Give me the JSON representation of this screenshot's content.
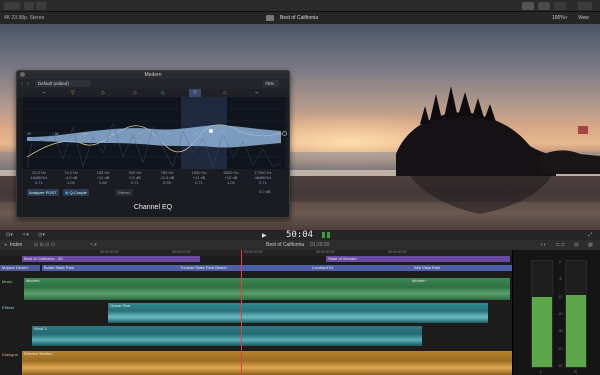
{
  "viewer_header": {
    "format": "4K 23.98p, Stereo",
    "library_title": "Best of California",
    "zoom": "100%",
    "view_label": "View"
  },
  "eq": {
    "window_title": "Modern",
    "preset": "Default (edited)",
    "percent": "75%",
    "name": "Channel EQ",
    "analyzer_label": "Analyzer",
    "analyzer_state": "POST",
    "q_couple": "Q-Couple",
    "processing": "Stereo",
    "freq_ticks": [
      "20",
      "50",
      "100",
      "200",
      "500",
      "1k",
      "2k",
      "5k",
      "10k",
      "20k"
    ],
    "bands": [
      {
        "freq": "20.0 Hz",
        "gain": "18dB/Oct",
        "q": "0.71"
      },
      {
        "freq": "74.0 Hz",
        "gain": "-4.0 dB",
        "q": "1.00"
      },
      {
        "freq": "105 Hz",
        "gain": "+12 dB",
        "q": "0.80"
      },
      {
        "freq": "500 Hz",
        "gain": "0.0 dB",
        "q": "0.71"
      },
      {
        "freq": "780 Hz",
        "gain": "-11.5 dB",
        "q": "0.39"
      },
      {
        "freq": "1500 Hz",
        "gain": "+11 dB",
        "q": "0.71"
      },
      {
        "freq": "6000 Hz",
        "gain": "+12 dB",
        "q": "1.00"
      },
      {
        "freq": "17000 Hz",
        "gain": "48dB/Oct",
        "q": "0.71"
      }
    ],
    "gain_out": "0.0 dB"
  },
  "playback": {
    "timecode": "50:04"
  },
  "timeline_header": {
    "index_label": "Index",
    "project": "Best of California",
    "duration": "01:20:20"
  },
  "ruler": [
    "00:00:00:00",
    "00:00:10:00",
    "00:00:20:00",
    "00:00:30:00",
    "00:00:40:00"
  ],
  "timeline": {
    "titles": [
      {
        "label": "Best of California - 3D"
      },
      {
        "label": "State of Wonder"
      }
    ],
    "locations": [
      {
        "label": "Mojave Desert"
      },
      {
        "label": "Bodie State Park"
      },
      {
        "label": "Trinidad State Park Beach"
      },
      {
        "label": "Lombard St."
      },
      {
        "label": "Alta Vista Park"
      }
    ],
    "role_labels": [
      "Music",
      "Effects",
      "Dialogue"
    ],
    "audio": [
      {
        "label": "Modern"
      },
      {
        "label": "Modern"
      },
      {
        "label": "Ocean Surf"
      },
      {
        "label": "Wind 3"
      },
      {
        "label": "Director Section"
      }
    ]
  },
  "meters": {
    "scale": [
      "0",
      "-6",
      "-12",
      "-20",
      "-30",
      "-40",
      "-50"
    ],
    "left_label": "L",
    "right_label": "R"
  }
}
